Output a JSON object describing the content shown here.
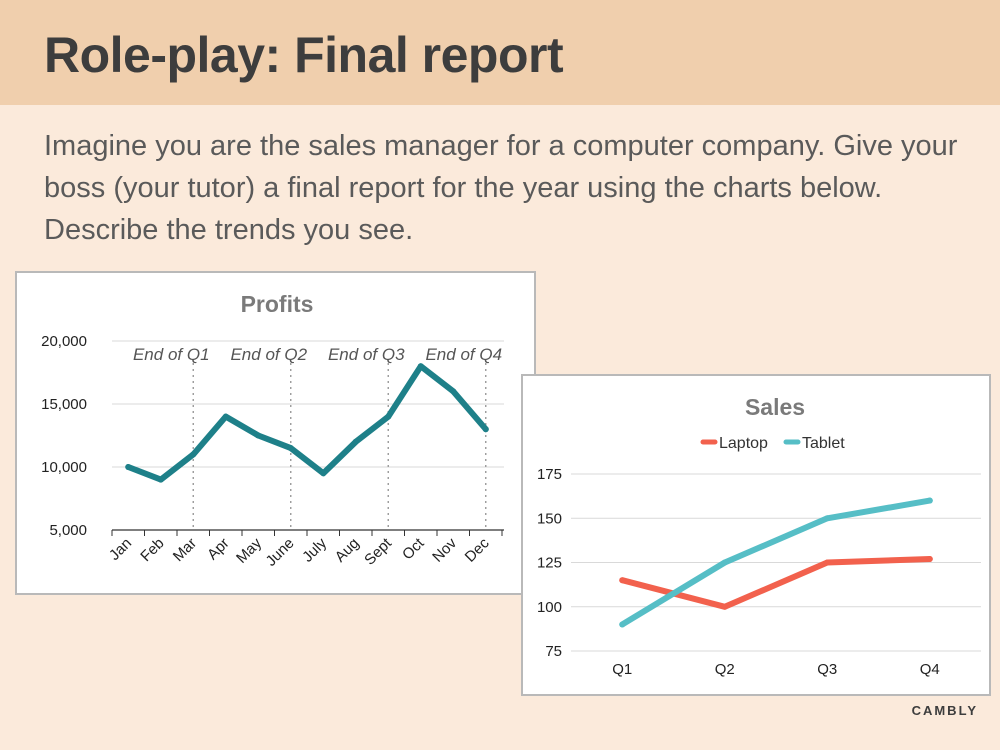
{
  "header": {
    "title": "Role-play: Final report"
  },
  "instructions": "Imagine you are the sales manager for a computer company. Give your boss (your tutor) a final report for the year using the charts below. Describe the trends you see.",
  "brand": "CAMBLY",
  "chart_data": [
    {
      "type": "line",
      "title": "Profits",
      "categories": [
        "Jan",
        "Feb",
        "Mar",
        "Apr",
        "May",
        "June",
        "July",
        "Aug",
        "Sept",
        "Oct",
        "Nov",
        "Dec"
      ],
      "series": [
        {
          "values": [
            10000,
            9000,
            11000,
            14000,
            12500,
            11500,
            9500,
            12000,
            14000,
            18000,
            16000,
            13000
          ],
          "color": "#1e8089"
        }
      ],
      "yticks": [
        "5,000",
        "10,000",
        "15,000",
        "20,000"
      ],
      "ylim": [
        5000,
        20000
      ],
      "grid": true,
      "annotations": [
        {
          "label": "End of Q1",
          "at": "Mar"
        },
        {
          "label": "End of Q2",
          "at": "June"
        },
        {
          "label": "End of Q3",
          "at": "Sept"
        },
        {
          "label": "End of Q4",
          "at": "Dec"
        }
      ]
    },
    {
      "type": "line",
      "title": "Sales",
      "categories": [
        "Q1",
        "Q2",
        "Q3",
        "Q4"
      ],
      "series": [
        {
          "name": "Laptop",
          "values": [
            115,
            100,
            125,
            127
          ],
          "color": "#f2614d"
        },
        {
          "name": "Tablet",
          "values": [
            90,
            125,
            150,
            160
          ],
          "color": "#56bec6"
        }
      ],
      "yticks": [
        "75",
        "100",
        "125",
        "150",
        "175"
      ],
      "ylim": [
        75,
        175
      ],
      "grid": true,
      "legend": "top"
    }
  ]
}
